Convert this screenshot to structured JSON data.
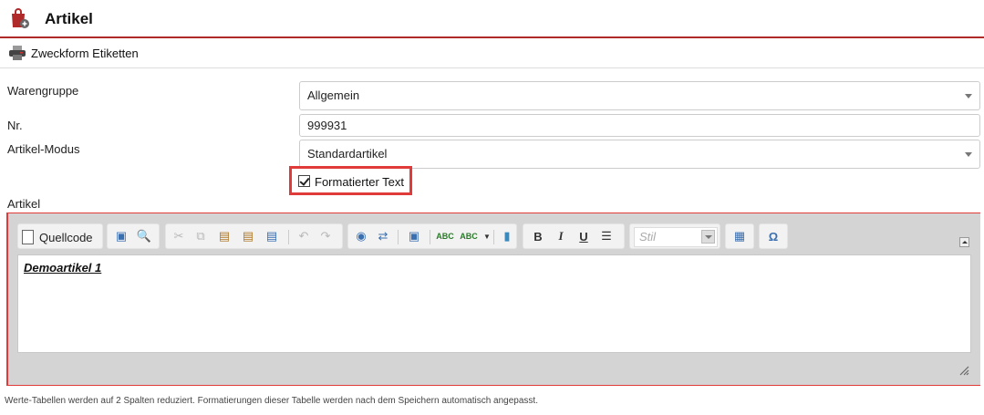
{
  "header": {
    "title": "Artikel",
    "icon": "shopping-bag-icon"
  },
  "toolbar": {
    "print_label": "Zweckform Etiketten",
    "print_icon": "printer-icon"
  },
  "form": {
    "warengruppe": {
      "label": "Warengruppe",
      "value": "Allgemein"
    },
    "nr": {
      "label": "Nr.",
      "value": "999931"
    },
    "modus": {
      "label": "Artikel-Modus",
      "value": "Standardartikel"
    },
    "formatted": {
      "label": "Formatierter Text",
      "checked": true
    },
    "artikel": {
      "label": "Artikel"
    }
  },
  "editor": {
    "source_label": "Quellcode",
    "style_placeholder": "Stil",
    "content": "Demoartikel 1",
    "buttons": [
      "maximize-icon",
      "preview-icon",
      "cut-icon",
      "copy-icon",
      "paste-icon",
      "paste-text-icon",
      "paste-word-icon",
      "undo-icon",
      "redo-icon",
      "find-icon",
      "replace-icon",
      "select-all-icon",
      "spellcheck-icon",
      "spellcheck-as-you-type-icon",
      "remove-format-icon",
      "bold-icon",
      "italic-icon",
      "underline-icon",
      "bulleted-list-icon",
      "table-icon",
      "special-char-icon"
    ]
  },
  "footer": {
    "note": "Werte-Tabellen werden auf 2 Spalten reduziert. Formatierungen dieser Tabelle werden nach dem Speichern automatisch angepasst."
  },
  "colors": {
    "accent": "#b02a2a",
    "highlight": "#e03a3a"
  }
}
